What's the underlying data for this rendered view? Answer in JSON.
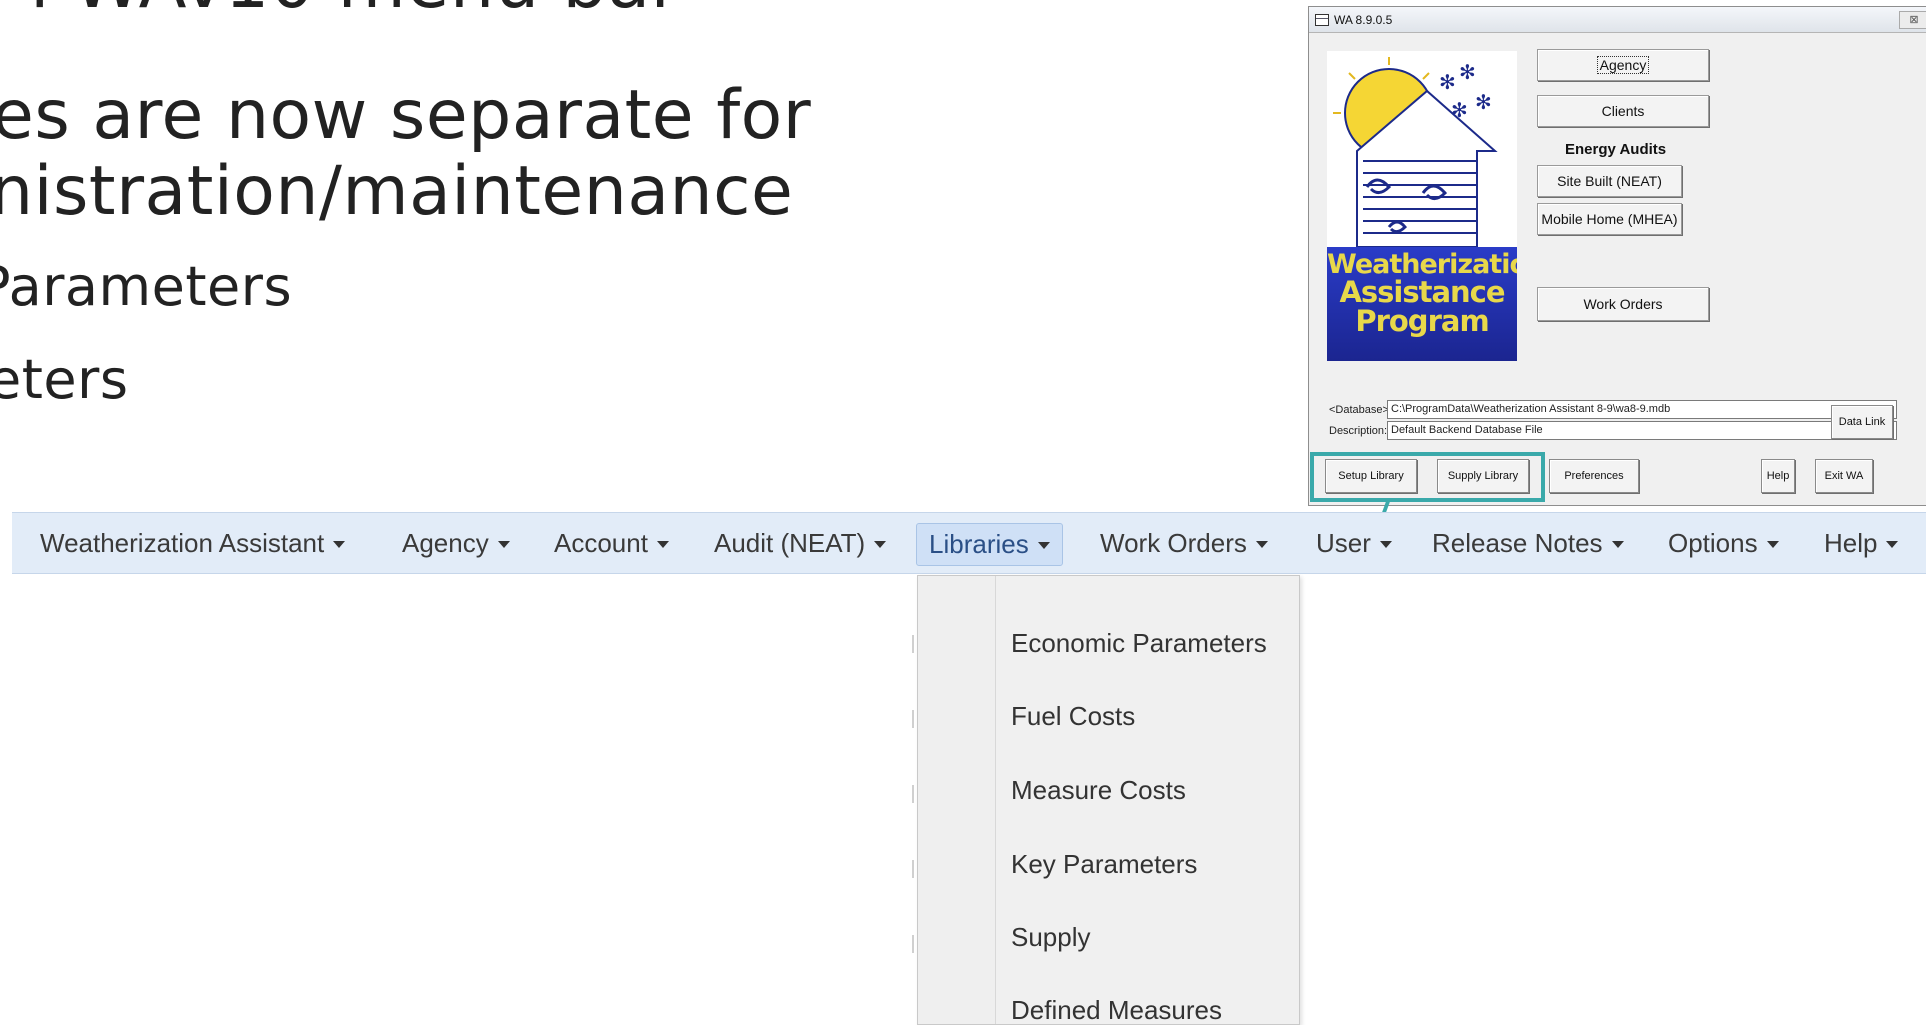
{
  "slide": {
    "lines": [
      "l WAv10 menu bar",
      "es are now separate for",
      "nistration/maintenance",
      "Parameters",
      "eters"
    ]
  },
  "legacy_window": {
    "title": "WA 8.9.0.5",
    "close_glyph": "⊠",
    "logo_lines": [
      "Weatherization",
      "Assistance",
      "Program"
    ],
    "buttons": {
      "agency": "Agency",
      "clients": "Clients",
      "energy_audits_heading": "Energy Audits",
      "site_built": "Site Built (NEAT)",
      "mobile_home": "Mobile Home (MHEA)",
      "work_orders": "Work Orders"
    },
    "database_label": "<Database>:",
    "database_value": "C:\\ProgramData\\Weatherization Assistant 8-9\\wa8-9.mdb",
    "description_label": "Description:",
    "description_value": "Default Backend Database File",
    "data_link": "Data Link",
    "bottom_buttons": {
      "setup_library": "Setup Library",
      "supply_library": "Supply Library",
      "preferences": "Preferences",
      "help": "Help",
      "exit": "Exit WA"
    },
    "highlight_color": "#3aa9aa"
  },
  "menubar": {
    "items": [
      "Weatherization Assistant",
      "Agency",
      "Account",
      "Audit (NEAT)",
      "Libraries",
      "Work Orders",
      "User",
      "Release Notes",
      "Options",
      "Help"
    ],
    "active": "Libraries"
  },
  "dropdown": {
    "items": [
      "Economic Parameters",
      "Fuel Costs",
      "Measure Costs",
      "Key Parameters",
      "Supply",
      "Defined Measures"
    ]
  }
}
